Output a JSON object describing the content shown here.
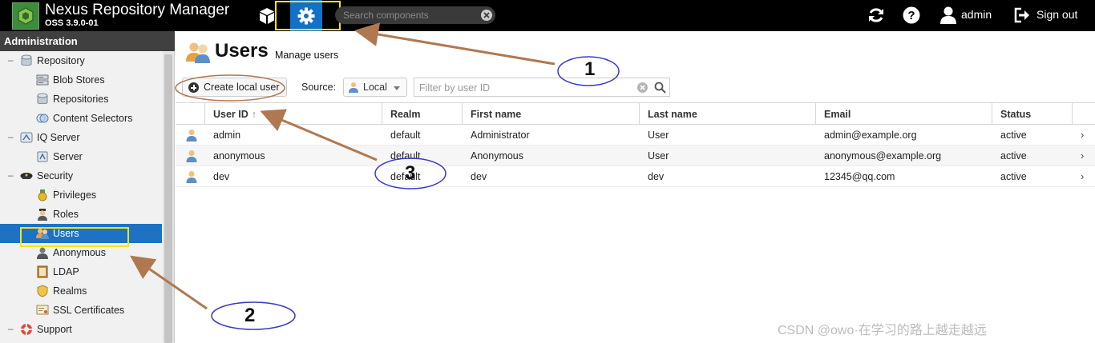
{
  "app": {
    "title": "Nexus Repository Manager",
    "version": "OSS 3.9.0-01",
    "search_placeholder": "Search components",
    "user": "admin",
    "sign_out": "Sign out",
    "brand_color": "#000000",
    "accent_color": "#1370c9"
  },
  "sidebar": {
    "header": "Administration",
    "items": [
      {
        "label": "Repository",
        "icon": "database-icon"
      },
      {
        "label": "Blob Stores",
        "icon": "server-icon"
      },
      {
        "label": "Repositories",
        "icon": "database-icon"
      },
      {
        "label": "Content Selectors",
        "icon": "selector-icon"
      },
      {
        "label": "IQ Server",
        "icon": "iq-icon"
      },
      {
        "label": "Server",
        "icon": "server-icon"
      },
      {
        "label": "Security",
        "icon": "police-cap-icon"
      },
      {
        "label": "Privileges",
        "icon": "medal-icon"
      },
      {
        "label": "Roles",
        "icon": "role-icon"
      },
      {
        "label": "Users",
        "icon": "users-icon",
        "selected": true
      },
      {
        "label": "Anonymous",
        "icon": "anonymous-icon"
      },
      {
        "label": "LDAP",
        "icon": "book-icon"
      },
      {
        "label": "Realms",
        "icon": "shield-icon"
      },
      {
        "label": "SSL Certificates",
        "icon": "certificate-icon"
      },
      {
        "label": "Support",
        "icon": "lifebuoy-icon"
      }
    ]
  },
  "main": {
    "title": "Users",
    "subtitle": "Manage users",
    "create_button": "Create local user",
    "source_label": "Source:",
    "source_value": "Local",
    "filter_placeholder": "Filter by user ID",
    "columns": [
      "User ID",
      "Realm",
      "First name",
      "Last name",
      "Email",
      "Status"
    ],
    "sort_indicator": "↑",
    "rows": [
      {
        "user_id": "admin",
        "realm": "default",
        "first_name": "Administrator",
        "last_name": "User",
        "email": "admin@example.org",
        "status": "active"
      },
      {
        "user_id": "anonymous",
        "realm": "default",
        "first_name": "Anonymous",
        "last_name": "User",
        "email": "anonymous@example.org",
        "status": "active"
      },
      {
        "user_id": "dev",
        "realm": "default",
        "first_name": "dev",
        "last_name": "dev",
        "email": "12345@qq.com",
        "status": "active"
      }
    ],
    "row_chevron": "›"
  },
  "annotations": {
    "labels": [
      "1",
      "2",
      "3"
    ],
    "color": "#b07850",
    "highlight_color": "#f5e31a"
  },
  "watermark": "CSDN @owo·在学习的路上越走越远"
}
